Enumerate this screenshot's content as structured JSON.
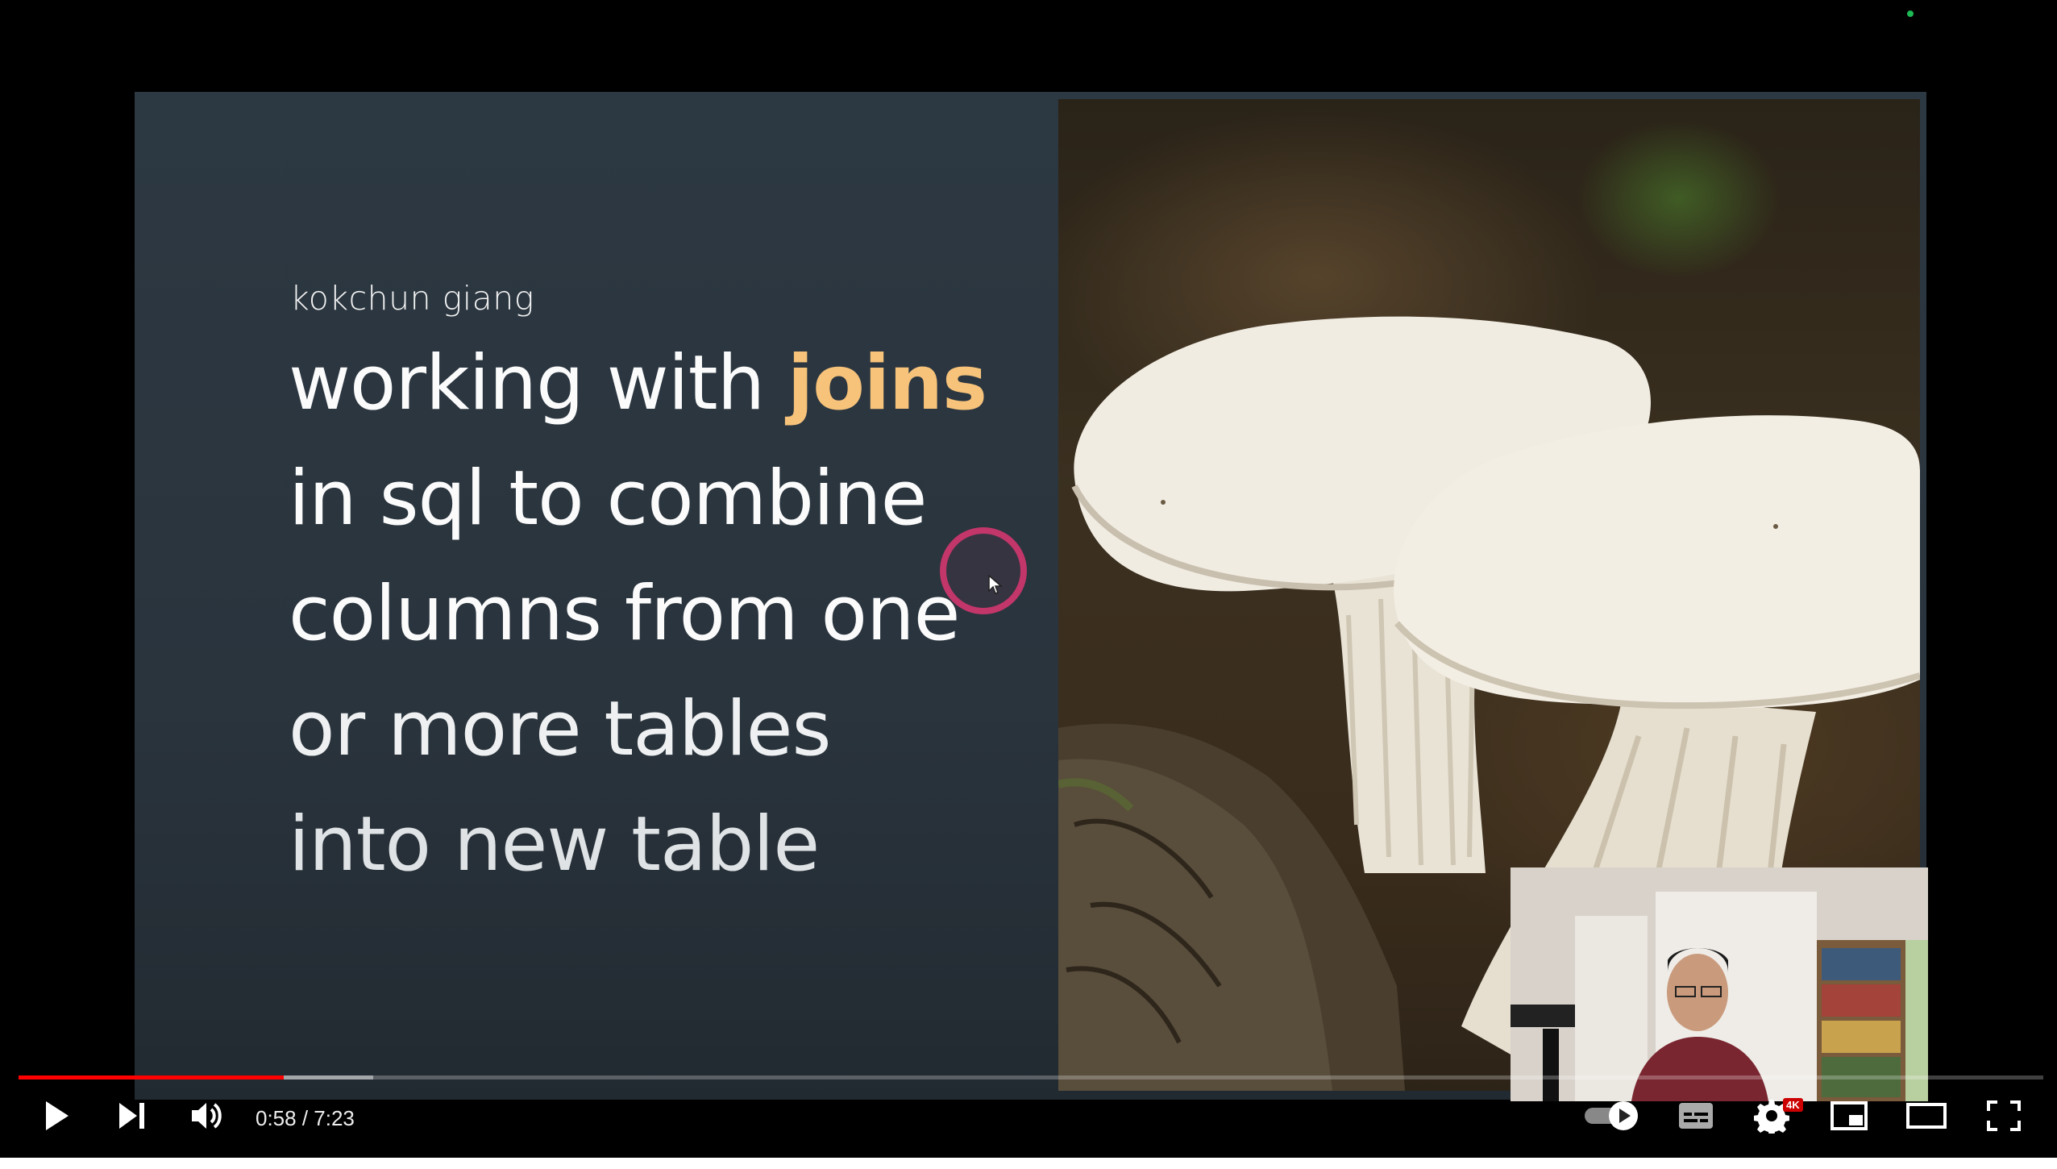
{
  "video": {
    "current_time": "0:58",
    "separator": " / ",
    "duration": "7:23",
    "played_fraction": 0.131,
    "buffered_fraction": 0.175,
    "quality_badge": "4K"
  },
  "slide": {
    "author": "kokchun giang",
    "title_line1_prefix": "working with ",
    "title_line1_accent": "joins",
    "title_line2": "in sql to combine",
    "title_line3": "columns from one",
    "title_line4": "or more tables",
    "title_line5": "into new table",
    "accent_color": "#f7c27a"
  },
  "controls": {
    "play": "play-icon",
    "next": "next-icon",
    "volume": "volume-icon",
    "autoplay": "autoplay-toggle-icon",
    "subtitles": "subtitles-icon",
    "settings": "gear-icon",
    "miniplayer": "miniplayer-icon",
    "theater": "theater-icon",
    "fullscreen": "fullscreen-icon"
  },
  "colors": {
    "progress_played": "#ff0000",
    "cursor_highlight": "#c2366a",
    "recording_dot": "#1db954"
  }
}
